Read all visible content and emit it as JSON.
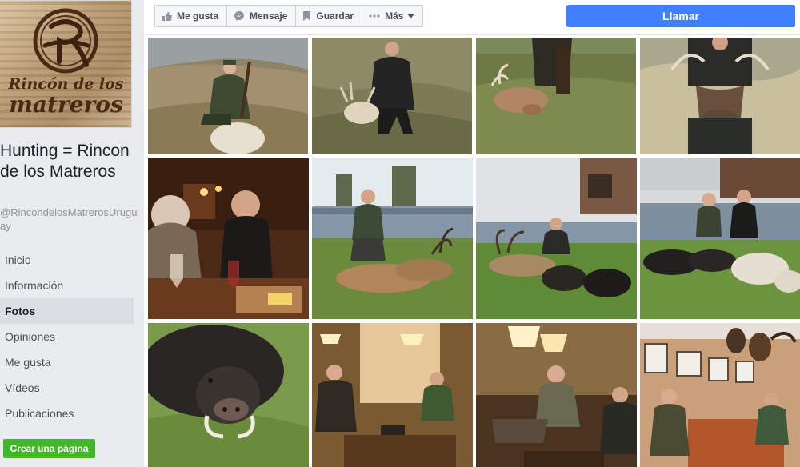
{
  "sidebar": {
    "logo": {
      "line1": "Rincón de los",
      "line2": "matreros"
    },
    "page_name": "Hunting = Rincon de los Matreros",
    "handle": "@RincondelosMatrerosUruguay",
    "nav": [
      {
        "label": "Inicio",
        "active": false
      },
      {
        "label": "Información",
        "active": false
      },
      {
        "label": "Fotos",
        "active": true
      },
      {
        "label": "Opiniones",
        "active": false
      },
      {
        "label": "Me gusta",
        "active": false
      },
      {
        "label": "Vídeos",
        "active": false
      },
      {
        "label": "Publicaciones",
        "active": false
      }
    ],
    "create_page": "Crear una página"
  },
  "actions": {
    "like": "Me gusta",
    "message": "Mensaje",
    "save": "Guardar",
    "more": "Más",
    "call": "Llamar"
  },
  "photos": [
    {
      "subject": "hunter-with-ram"
    },
    {
      "subject": "hunter-with-axis-deer"
    },
    {
      "subject": "hunter-with-fallow-deer"
    },
    {
      "subject": "hunter-with-red-stag"
    },
    {
      "subject": "dinner-table"
    },
    {
      "subject": "hunter-with-chital-pair"
    },
    {
      "subject": "hunter-with-deer-and-boars"
    },
    {
      "subject": "two-hunters-with-trophies"
    },
    {
      "subject": "wild-boar-closeup"
    },
    {
      "subject": "lodge-lounge-1"
    },
    {
      "subject": "lodge-lounge-2"
    },
    {
      "subject": "trophy-room"
    }
  ],
  "colors": {
    "facebook_blue": "#4080ff",
    "green_button": "#42b72a",
    "sidebar_bg": "#e9ebee"
  }
}
